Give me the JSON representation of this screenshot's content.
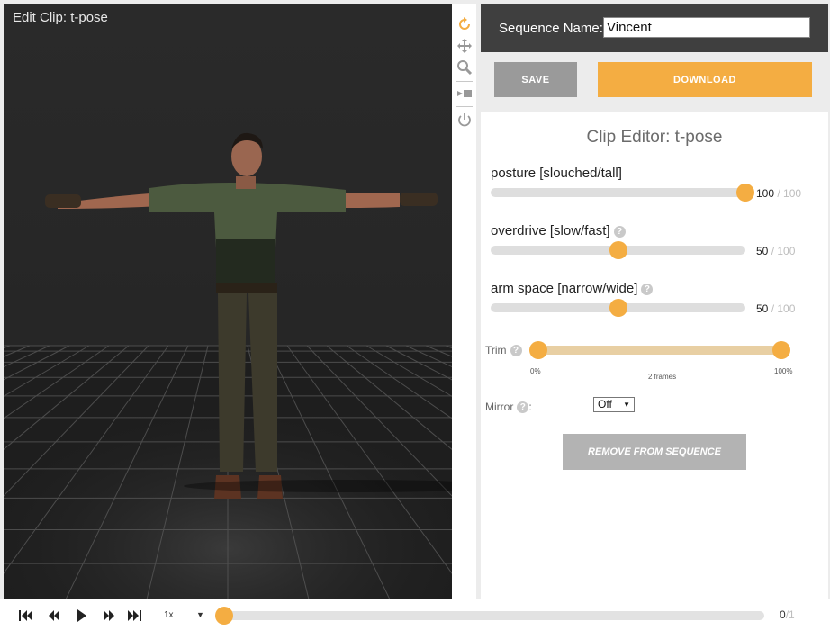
{
  "viewport": {
    "title": "Edit Clip: t-pose"
  },
  "toolbar": {
    "tools": [
      "reset-icon",
      "move-icon",
      "zoom-icon",
      "camera-icon",
      "power-icon"
    ],
    "accent": "#f4ad42"
  },
  "sequence": {
    "label": "Sequence Name:",
    "value": "Vincent"
  },
  "buttons": {
    "save": "SAVE",
    "download": "DOWNLOAD",
    "remove": "REMOVE FROM SEQUENCE"
  },
  "editor": {
    "title": "Clip Editor: t-pose",
    "params": [
      {
        "label": "posture [slouched/tall]",
        "value": "100",
        "max": "/ 100",
        "has_help": false,
        "fraction": 1.0
      },
      {
        "label": "overdrive [slow/fast]",
        "value": "50",
        "max": "/ 100",
        "has_help": true,
        "fraction": 0.5
      },
      {
        "label": "arm space [narrow/wide]",
        "value": "50",
        "max": "/ 100",
        "has_help": true,
        "fraction": 0.5
      }
    ],
    "trim": {
      "label": "Trim",
      "start_label": "0%",
      "end_label": "100%",
      "frames_label": "2 frames",
      "start": 0.0,
      "end": 1.0
    },
    "mirror": {
      "label": "Mirror",
      "suffix": ":",
      "value": "Off"
    },
    "help_glyph": "?"
  },
  "playback": {
    "speed": "1x",
    "speed_arrow": "▼",
    "current_frame": "0",
    "total_frames": "/1",
    "progress": 0.0
  },
  "colors": {
    "accent": "#f4ad42",
    "header": "#3f3f3f",
    "trim_track": "#e8cfa3"
  }
}
